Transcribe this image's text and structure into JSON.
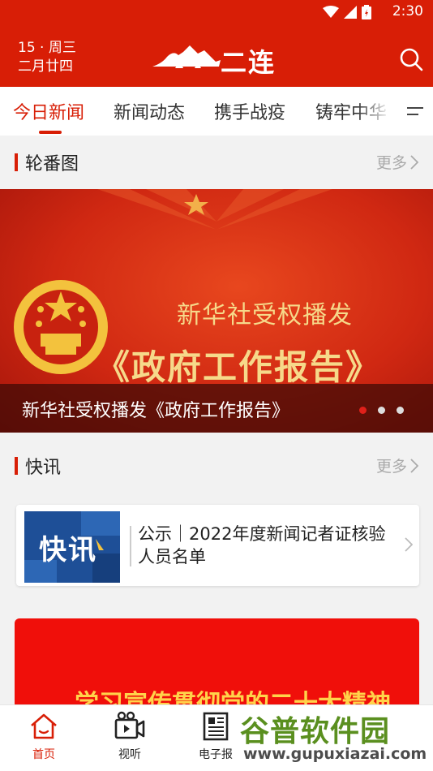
{
  "status_bar": {
    "time": "2:30",
    "icons": [
      "wifi-icon",
      "signal-icon",
      "battery-icon"
    ]
  },
  "header": {
    "date_line1": "15 · 周三",
    "date_line2": "二月廿四",
    "logo_text": "二连",
    "search_icon": "search-icon",
    "background": "#d81e06"
  },
  "tabs": {
    "items": [
      {
        "label": "今日新闻",
        "active": true
      },
      {
        "label": "新闻动态"
      },
      {
        "label": "携手战疫"
      },
      {
        "label": "铸牢中华"
      }
    ],
    "menu_icon": "menu-icon"
  },
  "carousel_section": {
    "title": "轮番图",
    "more": "更多"
  },
  "carousel": {
    "banner_line1": "新华社受权播发",
    "banner_line2": "《政府工作报告》",
    "caption": "新华社受权播发《政府工作报告》",
    "dots": 3,
    "active_dot": 0
  },
  "flash_section": {
    "title": "快讯",
    "more": "更多"
  },
  "news_card": {
    "thumb_text": "快讯",
    "title": "公示｜2022年度新闻记者证核验人员名单"
  },
  "promo": {
    "text": "学习宣传贯彻党的二十大精神"
  },
  "bottom_nav": {
    "items": [
      {
        "label": "首页",
        "icon": "home-icon",
        "active": true
      },
      {
        "label": "视听",
        "icon": "video-icon"
      },
      {
        "label": "电子报",
        "icon": "newspaper-icon"
      }
    ]
  },
  "watermark": {
    "title": "谷普软件园",
    "url": "www.gupuxiazai.com"
  },
  "colors": {
    "accent": "#d81e06",
    "promo_red": "#f00f0a",
    "gold": "#f6d98a"
  }
}
